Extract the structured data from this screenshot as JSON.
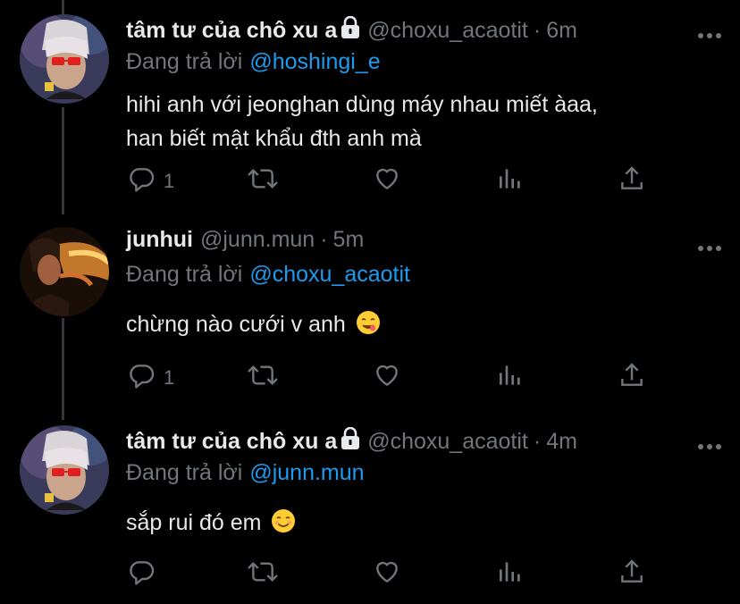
{
  "tweets": [
    {
      "name": "tâm tư của chô xu a",
      "handle": "@choxu_acaotit",
      "sep": "·",
      "time": "6m",
      "replying_prefix": "Đang trả lời",
      "replying_to": "@hoshingi_e",
      "text_line1": "hihi anh với jeonghan dùng máy nhau miết àaa,",
      "text_line2": "han biết mật khẩu đth anh mà",
      "reply_count": "1",
      "protected": true
    },
    {
      "name": "junhui",
      "handle": "@junn.mun",
      "sep": "·",
      "time": "5m",
      "replying_prefix": "Đang trả lời",
      "replying_to": "@choxu_acaotit",
      "text_line1": "chừng nào cưới v anh",
      "text_line2": "",
      "reply_count": "1",
      "protected": false
    },
    {
      "name": "tâm tư của chô xu a",
      "handle": "@choxu_acaotit",
      "sep": "·",
      "time": "4m",
      "replying_prefix": "Đang trả lời",
      "replying_to": "@junn.mun",
      "text_line1": "sắp rui đó em",
      "text_line2": "",
      "reply_count": "",
      "protected": true
    }
  ],
  "icons": {
    "reply": "reply-icon",
    "retweet": "retweet-icon",
    "like": "heart-icon",
    "views": "analytics-icon",
    "share": "share-icon",
    "more": "more-icon",
    "lock": "lock-icon",
    "emoji": "smiling-face-emoji"
  },
  "colors": {
    "background": "#000000",
    "text": "#e7e9ea",
    "muted": "#71767b",
    "accent": "#1d9bf0",
    "thread_line": "#333639"
  }
}
